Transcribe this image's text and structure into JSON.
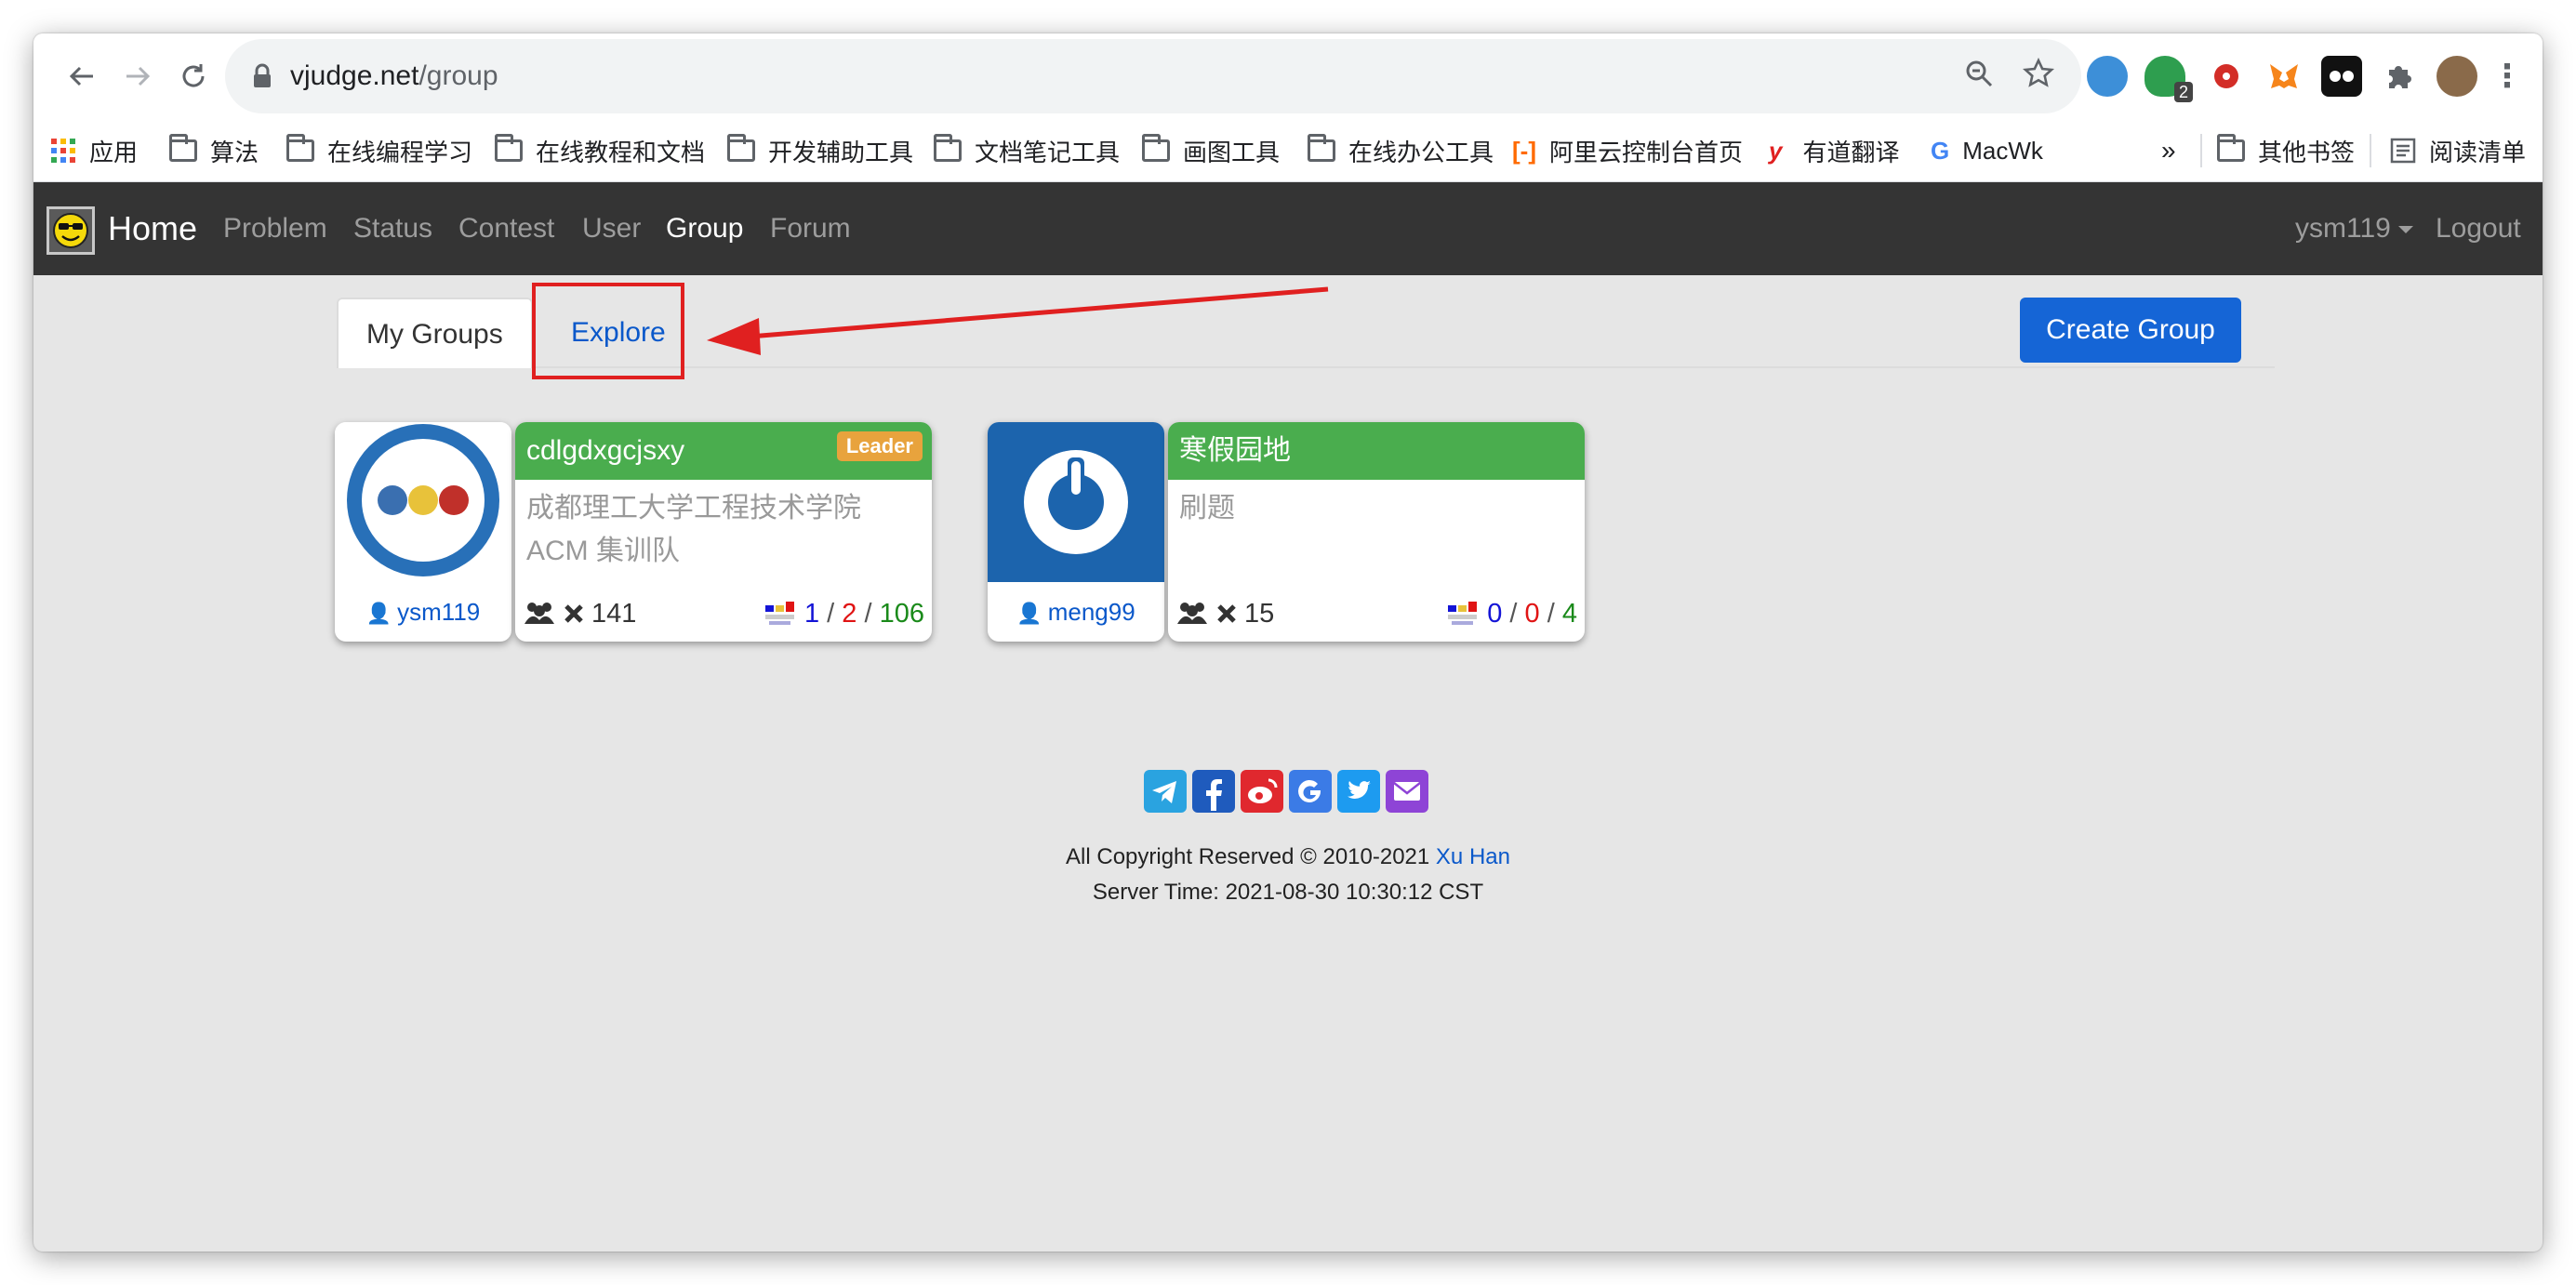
{
  "browser": {
    "url_host": "vjudge.net",
    "url_path": "/group",
    "extension_badge": "2"
  },
  "bookmarks": [
    {
      "label": "应用",
      "icon": "apps-grid-icon"
    },
    {
      "label": "算法",
      "icon": "folder-icon"
    },
    {
      "label": "在线编程学习",
      "icon": "folder-icon"
    },
    {
      "label": "在线教程和文档",
      "icon": "folder-icon"
    },
    {
      "label": "开发辅助工具",
      "icon": "folder-icon"
    },
    {
      "label": "文档笔记工具",
      "icon": "folder-icon"
    },
    {
      "label": "画图工具",
      "icon": "folder-icon"
    },
    {
      "label": "在线办公工具",
      "icon": "folder-icon"
    },
    {
      "label": "阿里云控制台首页",
      "icon": "aliyun-icon"
    },
    {
      "label": "有道翻译",
      "icon": "youdao-icon"
    },
    {
      "label": "MacWk",
      "icon": "google-icon"
    }
  ],
  "bookmarks_more": "»",
  "bookmarks_other": "其他书签",
  "bookmarks_reading": "阅读清单",
  "navbar": {
    "home": "Home",
    "links": [
      "Problem",
      "Status",
      "Contest",
      "User",
      "Group",
      "Forum"
    ],
    "active": "Group",
    "user": "ysm119",
    "logout": "Logout"
  },
  "tabs": {
    "my_groups": "My Groups",
    "explore": "Explore"
  },
  "create_group": "Create Group",
  "groups": [
    {
      "name": "cdlgdxgcjsxy",
      "badge": "Leader",
      "description": "成都理工大学工程技术学院 ACM 集训队",
      "owner": "ysm119",
      "members": "141",
      "contests_running": "1",
      "contests_scheduled": "2",
      "contests_ended": "106",
      "sep": "/"
    },
    {
      "name": "寒假园地",
      "badge": "",
      "description": "刷题",
      "owner": "meng99",
      "members": "15",
      "contests_running": "0",
      "contests_scheduled": "0",
      "contests_ended": "4",
      "sep": "/"
    }
  ],
  "colors": {
    "navbar_bg": "#343434",
    "group_header": "#4aad4e",
    "leader_badge": "#e8a33d",
    "primary": "#1565d6",
    "annotation_red": "#e02020"
  },
  "footer": {
    "copyright": "All Copyright Reserved © 2010-2021",
    "author": "Xu Han",
    "server_time": "Server Time: 2021-08-30 10:30:12 CST",
    "socials": [
      "telegram-icon",
      "facebook-icon",
      "weibo-icon",
      "google-icon",
      "twitter-icon",
      "email-icon"
    ]
  }
}
